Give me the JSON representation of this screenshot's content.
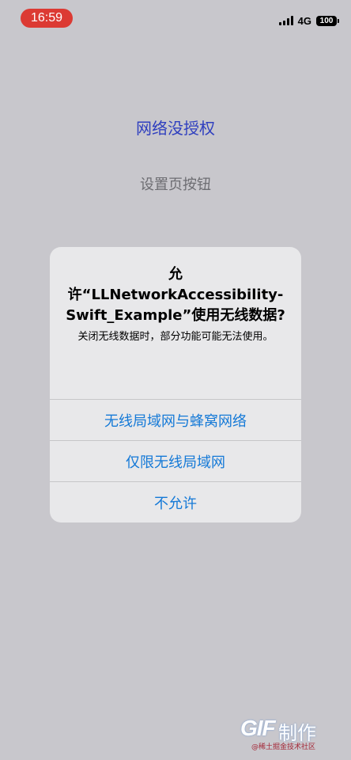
{
  "status_bar": {
    "time": "16:59",
    "network": "4G",
    "battery": "100",
    "time_color": "#dc3a33"
  },
  "screen": {
    "title": "网络没授权",
    "settings_button": "设置页按钮"
  },
  "alert": {
    "title": "允许“LLNetworkAccessibility-Swift_Example”使用无线数据?",
    "message": "关闭无线数据时，部分功能可能无法使用。",
    "actions": [
      "无线局域网与蜂窝网络",
      "仅限无线局域网",
      "不允许"
    ],
    "action_color": "#1479d7"
  },
  "watermark": {
    "logo": "GIF",
    "text": "制作",
    "subtext": "@稀土掘金技术社区"
  },
  "icons": {
    "signal": "cellular-signal-icon",
    "battery": "battery-icon"
  }
}
